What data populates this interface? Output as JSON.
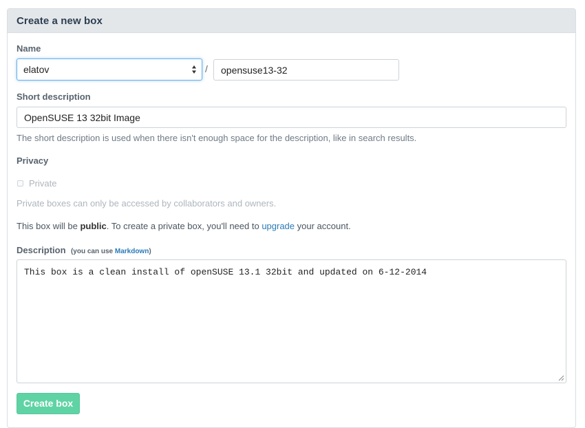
{
  "panel": {
    "title": "Create a new box"
  },
  "name": {
    "label": "Name",
    "owner_selected": "elatov",
    "separator": "/",
    "box_name_value": "opensuse13-32"
  },
  "short_description": {
    "label": "Short description",
    "value": "OpenSUSE 13 32bit Image",
    "help": "The short description is used when there isn't enough space for the description, like in search results."
  },
  "privacy": {
    "label": "Privacy",
    "checkbox_label": "Private",
    "checked": false,
    "help": "Private boxes can only be accessed by collaborators and owners.",
    "notice_prefix": "This box will be ",
    "notice_bold": "public",
    "notice_middle": ". To create a private box, you'll need to ",
    "notice_link": "upgrade",
    "notice_suffix": " your account."
  },
  "description": {
    "label": "Description",
    "hint_prefix": "(you can use ",
    "hint_link": "Markdown",
    "hint_suffix": ")",
    "value": "This box is a clean install of openSUSE 13.1 32bit and updated on 6-12-2014"
  },
  "actions": {
    "create_label": "Create box"
  },
  "colors": {
    "primary_button": "#5fd3a4",
    "link": "#2a7ab8",
    "focus_border": "#66afe9"
  }
}
